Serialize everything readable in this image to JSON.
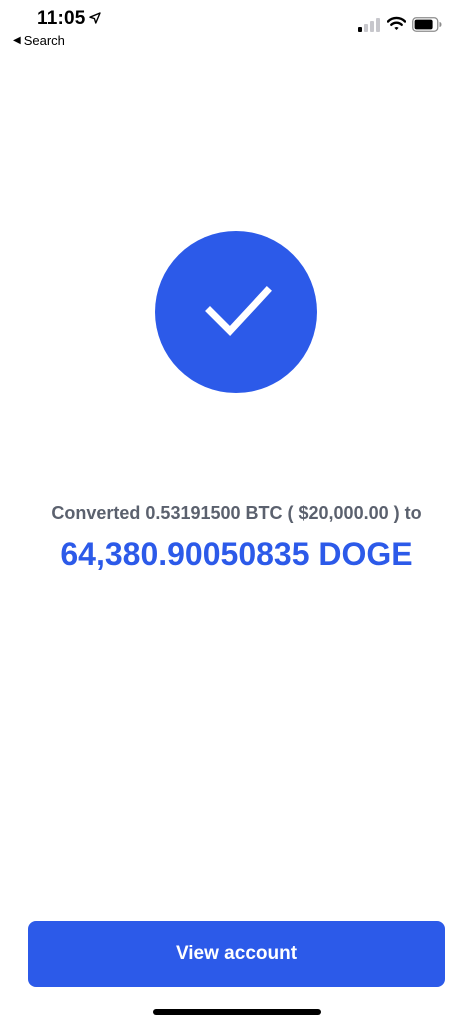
{
  "status_bar": {
    "time": "11:05",
    "back_label": "Search",
    "location_icon": "location-arrow-icon",
    "signal_icon": "cellular-signal-icon",
    "wifi_icon": "wifi-icon",
    "battery_icon": "battery-icon"
  },
  "confirmation": {
    "icon": "checkmark-icon",
    "converted_text": "Converted 0.53191500 BTC ( $20,000.00 ) to",
    "result_amount": "64,380.90050835 DOGE"
  },
  "actions": {
    "view_account_label": "View account"
  },
  "colors": {
    "accent": "#2c5ae9",
    "secondary_text": "#5b616e",
    "background": "#ffffff"
  }
}
